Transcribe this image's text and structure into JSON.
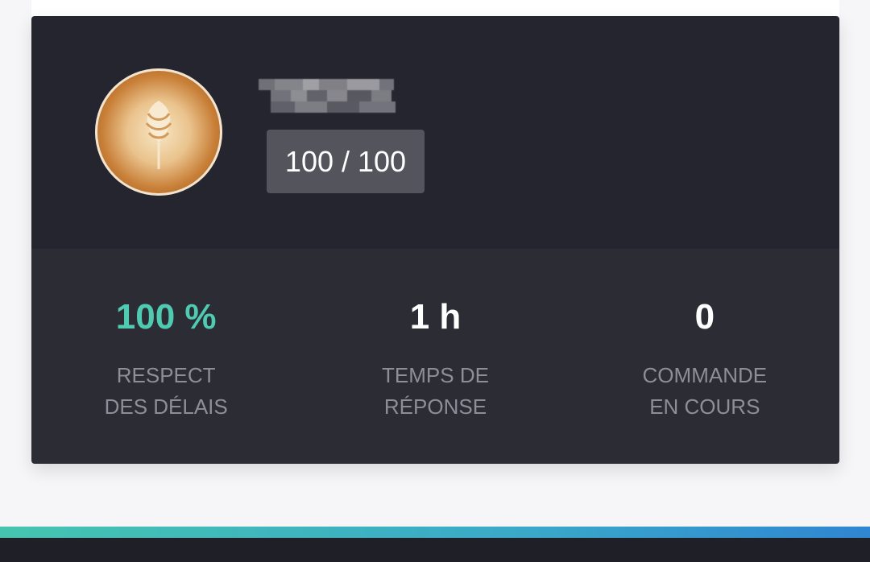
{
  "profile": {
    "score": "100 / 100",
    "avatar_icon": "latte-art-avatar"
  },
  "stats": [
    {
      "value": "100 %",
      "label_line1": "RESPECT",
      "label_line2": "DES DÉLAIS"
    },
    {
      "value": "1 h",
      "label_line1": "TEMPS DE",
      "label_line2": "RÉPONSE"
    },
    {
      "value": "0",
      "label_line1": "COMMANDE",
      "label_line2": "EN COURS"
    }
  ],
  "colors": {
    "header_bg": "#25252f",
    "stats_bg": "#2c2c35",
    "accent": "#4ecbb0",
    "badge_bg": "#54545d"
  }
}
